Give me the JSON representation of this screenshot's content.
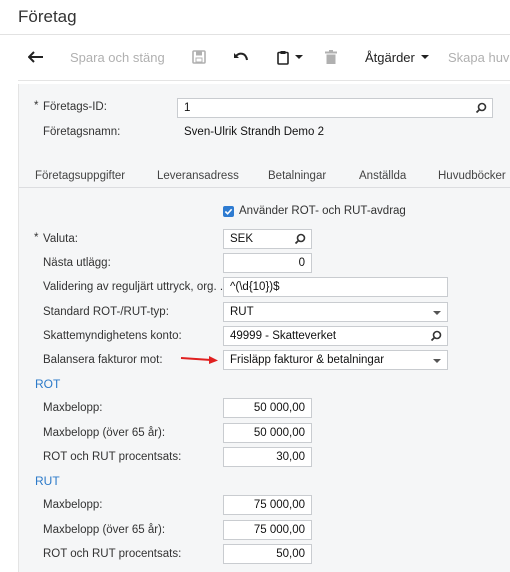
{
  "page": {
    "title": "Företag"
  },
  "toolbar": {
    "save_close_label": "Spara och stäng",
    "actions_label": "Åtgärder",
    "create_label": "Skapa huv"
  },
  "header_fields": {
    "company_id": {
      "label": "Företags-ID:",
      "value": "1",
      "icon": "search-icon"
    },
    "company_name": {
      "label": "Företagsnamn:",
      "value": "Sven-Ulrik Strandh Demo 2"
    }
  },
  "tabs": [
    {
      "label": "Företagsuppgifter"
    },
    {
      "label": "Leveransadress"
    },
    {
      "label": "Betalningar"
    },
    {
      "label": "Anställda"
    },
    {
      "label": "Huvudböcker"
    }
  ],
  "form": {
    "rot_rut_checkbox": {
      "label": "Använder ROT- och RUT-avdrag",
      "checked": true
    },
    "currency": {
      "label": "Valuta:",
      "value": "SEK"
    },
    "next_fee": {
      "label": "Nästa utlägg:",
      "value": "0"
    },
    "validation": {
      "label": "Validering av reguljärt uttryck, org. ...",
      "value": "^(\\d{10})$"
    },
    "default_type": {
      "label": "Standard ROT-/RUT-typ:",
      "value": "RUT"
    },
    "tax_account": {
      "label": "Skattemyndighetens konto:",
      "value": "49999 - Skatteverket"
    },
    "balance_against": {
      "label": "Balansera fakturor mot:",
      "value": "Frisläpp fakturor & betalningar"
    }
  },
  "rot": {
    "title": "ROT",
    "max_amount": {
      "label": "Maxbelopp:",
      "value": "50 000,00"
    },
    "max_amount_65": {
      "label": "Maxbelopp (över 65 år):",
      "value": "50 000,00"
    },
    "percent": {
      "label": "ROT och RUT procentsats:",
      "value": "30,00"
    }
  },
  "rut": {
    "title": "RUT",
    "max_amount": {
      "label": "Maxbelopp:",
      "value": "75 000,00"
    },
    "max_amount_65": {
      "label": "Maxbelopp (över 65 år):",
      "value": "75 000,00"
    },
    "percent": {
      "label": "ROT och RUT procentsats:",
      "value": "50,00"
    }
  },
  "colors": {
    "accent": "#2e7bd1",
    "section": "#2c7ac9",
    "annotation_arrow": "#e02020"
  }
}
